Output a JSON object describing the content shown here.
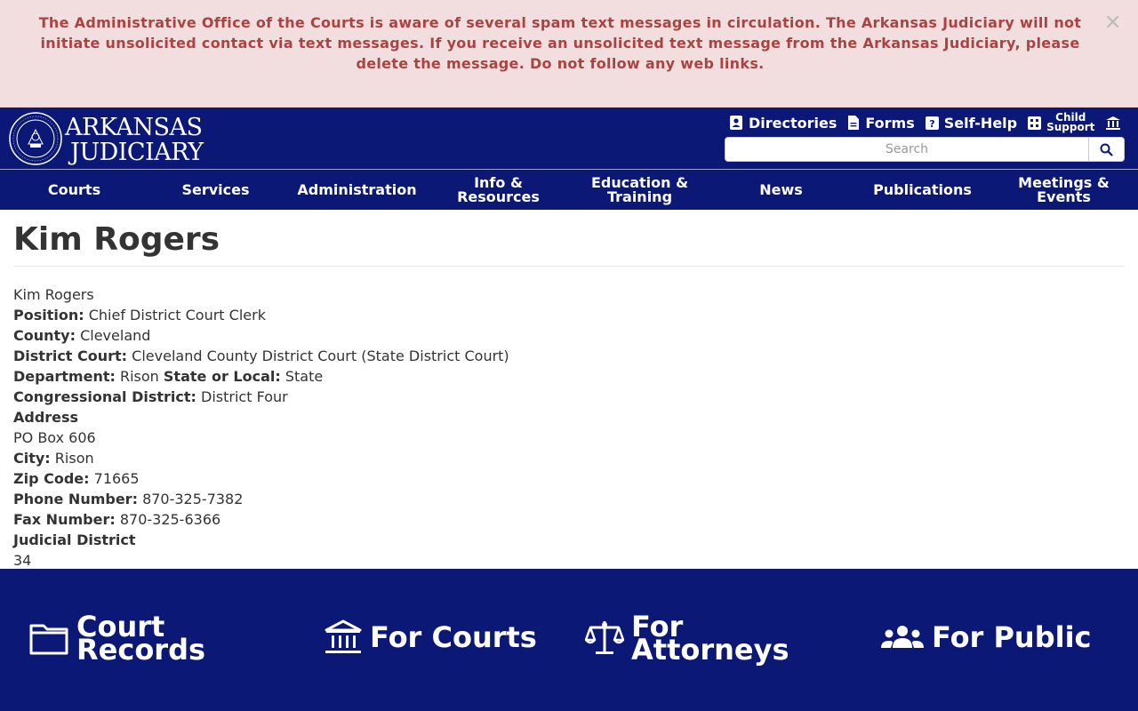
{
  "alert": {
    "message": "The Administrative Office of the Courts is aware of several spam text messages in circulation.  The Arkansas Judiciary will not initiate unsolicited contact via text messages. If you receive an unsolicited text message from the Arkansas Judiciary, please delete the message. Do not follow any web links.",
    "close": "×"
  },
  "logo": {
    "line1": "ARKANSAS",
    "line2": "JUDICIARY"
  },
  "util": {
    "directories": "Directories",
    "forms": "Forms",
    "self_help": "Self-Help",
    "child_support_1": "Child",
    "child_support_2": "Support"
  },
  "search": {
    "placeholder": "Search"
  },
  "nav": [
    {
      "label": "Courts"
    },
    {
      "label": "Services"
    },
    {
      "label": "Administration"
    },
    {
      "label": "Info & Resources"
    },
    {
      "label": "Education & Training"
    },
    {
      "label": "News"
    },
    {
      "label": "Publications"
    },
    {
      "label": "Meetings & Events"
    }
  ],
  "page": {
    "title": "Kim Rogers",
    "name": "Kim Rogers",
    "position_label": "Position:",
    "position": "Chief District Court Clerk",
    "county_label": "County:",
    "county": "Cleveland",
    "district_court_label": "District Court:",
    "district_court": "Cleveland County District Court (State District Court)",
    "department_label": "Department:",
    "department": "Rison",
    "state_local_label": "State or Local:",
    "state_local": "State",
    "congressional_label": "Congressional District:",
    "congressional": "District Four",
    "address_label": "Address",
    "address": "PO Box 606",
    "city_label": "City:",
    "city": "Rison",
    "zip_label": "Zip Code:",
    "zip": "71665",
    "phone_label": "Phone Number:",
    "phone": "870-325-7382",
    "fax_label": "Fax Number:",
    "fax": "870-325-6366",
    "judicial_label": "Judicial District",
    "judicial": "34"
  },
  "footer": {
    "court_records_1": "Court",
    "court_records_2": "Records",
    "for_courts": "For Courts",
    "for_attorneys_1": "For",
    "for_attorneys_2": "Attorneys",
    "for_public": "For Public"
  },
  "colors": {
    "navy": "#0b1875",
    "alert_bg": "#f2dede",
    "alert_text": "#a94442"
  }
}
